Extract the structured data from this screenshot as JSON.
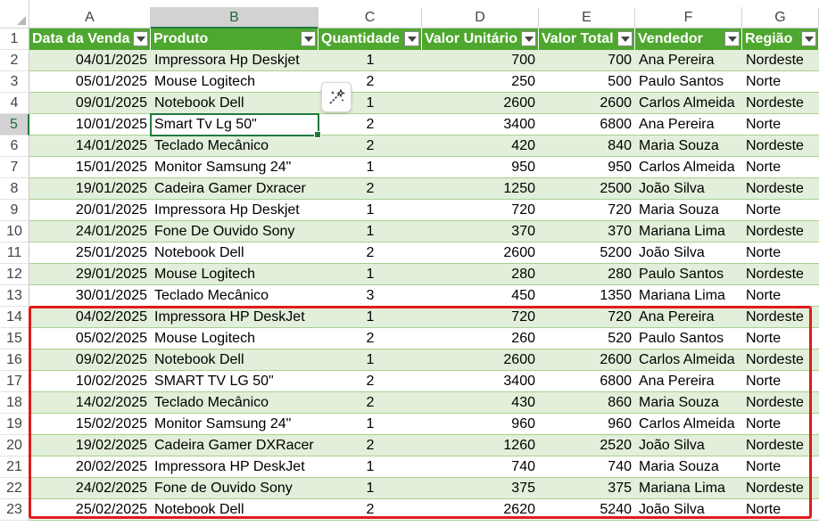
{
  "columns": [
    "A",
    "B",
    "C",
    "D",
    "E",
    "F",
    "G"
  ],
  "selected_column": "B",
  "selected_row": 5,
  "header_row_number": 1,
  "headers": [
    "Data da Venda",
    "Produto",
    "Quantidade",
    "Valor Unitário",
    "Valor Total",
    "Vendedor",
    "Região"
  ],
  "rows": [
    {
      "n": 2,
      "date": "04/01/2025",
      "product": "Impressora Hp Deskjet",
      "qty": "1",
      "unit": "700",
      "total": "700",
      "seller": "Ana Pereira",
      "region": "Nordeste"
    },
    {
      "n": 3,
      "date": "05/01/2025",
      "product": "Mouse Logitech",
      "qty": "2",
      "unit": "250",
      "total": "500",
      "seller": "Paulo Santos",
      "region": "Norte"
    },
    {
      "n": 4,
      "date": "09/01/2025",
      "product": "Notebook Dell",
      "qty": "1",
      "unit": "2600",
      "total": "2600",
      "seller": "Carlos Almeida",
      "region": "Nordeste"
    },
    {
      "n": 5,
      "date": "10/01/2025",
      "product": "Smart Tv Lg 50\"",
      "qty": "2",
      "unit": "3400",
      "total": "6800",
      "seller": "Ana Pereira",
      "region": "Norte"
    },
    {
      "n": 6,
      "date": "14/01/2025",
      "product": "Teclado Mecânico",
      "qty": "2",
      "unit": "420",
      "total": "840",
      "seller": "Maria Souza",
      "region": "Nordeste"
    },
    {
      "n": 7,
      "date": "15/01/2025",
      "product": "Monitor Samsung 24\"",
      "qty": "1",
      "unit": "950",
      "total": "950",
      "seller": "Carlos Almeida",
      "region": "Norte"
    },
    {
      "n": 8,
      "date": "19/01/2025",
      "product": "Cadeira Gamer Dxracer",
      "qty": "2",
      "unit": "1250",
      "total": "2500",
      "seller": "João Silva",
      "region": "Nordeste"
    },
    {
      "n": 9,
      "date": "20/01/2025",
      "product": "Impressora Hp Deskjet",
      "qty": "1",
      "unit": "720",
      "total": "720",
      "seller": "Maria Souza",
      "region": "Norte"
    },
    {
      "n": 10,
      "date": "24/01/2025",
      "product": "Fone De Ouvido Sony",
      "qty": "1",
      "unit": "370",
      "total": "370",
      "seller": "Mariana Lima",
      "region": "Nordeste"
    },
    {
      "n": 11,
      "date": "25/01/2025",
      "product": "Notebook Dell",
      "qty": "2",
      "unit": "2600",
      "total": "5200",
      "seller": "João Silva",
      "region": "Norte"
    },
    {
      "n": 12,
      "date": "29/01/2025",
      "product": "Mouse Logitech",
      "qty": "1",
      "unit": "280",
      "total": "280",
      "seller": "Paulo Santos",
      "region": "Nordeste"
    },
    {
      "n": 13,
      "date": "30/01/2025",
      "product": "Teclado Mecânico",
      "qty": "3",
      "unit": "450",
      "total": "1350",
      "seller": "Mariana Lima",
      "region": "Norte"
    },
    {
      "n": 14,
      "date": "04/02/2025",
      "product": "Impressora HP DeskJet",
      "qty": "1",
      "unit": "720",
      "total": "720",
      "seller": "Ana Pereira",
      "region": "Nordeste"
    },
    {
      "n": 15,
      "date": "05/02/2025",
      "product": "Mouse Logitech",
      "qty": "2",
      "unit": "260",
      "total": "520",
      "seller": "Paulo Santos",
      "region": "Norte"
    },
    {
      "n": 16,
      "date": "09/02/2025",
      "product": "Notebook Dell",
      "qty": "1",
      "unit": "2600",
      "total": "2600",
      "seller": "Carlos Almeida",
      "region": "Nordeste"
    },
    {
      "n": 17,
      "date": "10/02/2025",
      "product": "SMART TV LG 50\"",
      "qty": "2",
      "unit": "3400",
      "total": "6800",
      "seller": "Ana Pereira",
      "region": "Norte"
    },
    {
      "n": 18,
      "date": "14/02/2025",
      "product": "Teclado Mecânico",
      "qty": "2",
      "unit": "430",
      "total": "860",
      "seller": "Maria Souza",
      "region": "Nordeste"
    },
    {
      "n": 19,
      "date": "15/02/2025",
      "product": "Monitor Samsung 24\"",
      "qty": "1",
      "unit": "960",
      "total": "960",
      "seller": "Carlos Almeida",
      "region": "Norte"
    },
    {
      "n": 20,
      "date": "19/02/2025",
      "product": "Cadeira Gamer DXRacer",
      "qty": "2",
      "unit": "1260",
      "total": "2520",
      "seller": "João Silva",
      "region": "Nordeste"
    },
    {
      "n": 21,
      "date": "20/02/2025",
      "product": "Impressora HP DeskJet",
      "qty": "1",
      "unit": "740",
      "total": "740",
      "seller": "Maria Souza",
      "region": "Norte"
    },
    {
      "n": 22,
      "date": "24/02/2025",
      "product": "Fone de Ouvido Sony",
      "qty": "1",
      "unit": "375",
      "total": "375",
      "seller": "Mariana Lima",
      "region": "Nordeste"
    },
    {
      "n": 23,
      "date": "25/02/2025",
      "product": "Notebook Dell",
      "qty": "2",
      "unit": "2620",
      "total": "5240",
      "seller": "João Silva",
      "region": "Norte"
    }
  ],
  "highlight": {
    "color": "#e01b1b"
  },
  "colors": {
    "header_green": "#4ea72e",
    "band_green": "#e2efda",
    "selection": "#1f7a3f"
  },
  "quick_analysis_icon": "sparkle-wand-icon"
}
